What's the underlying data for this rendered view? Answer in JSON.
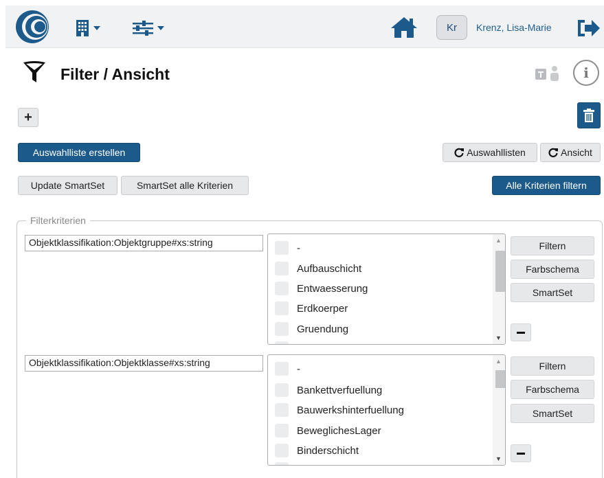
{
  "header": {
    "user_initials": "Kr",
    "user_name": "Krenz, Lisa-Marie",
    "icons": [
      "logo-icon",
      "building-icon",
      "sliders-icon",
      "home-icon",
      "logout-icon"
    ]
  },
  "page": {
    "title": "Filter / Ansicht",
    "icons": [
      "funnel-icon",
      "teams-icon",
      "info-icon"
    ],
    "info_glyph": "i"
  },
  "toolbar": {
    "add_label": "+",
    "create_list_label": "Auswahlliste erstellen",
    "refresh_lists_label": "Auswahllisten",
    "refresh_view_label": "Ansicht",
    "update_smartset_label": "Update SmartSet",
    "smartset_all_label": "SmartSet alle Kriterien",
    "filter_all_label": "Alle Kriterien filtern"
  },
  "filter_section": {
    "legend": "Filterkriterien",
    "criteria": [
      {
        "field": "Objektklassifikation:Objektgruppe#xs:string",
        "options": [
          "-",
          "Aufbauschicht",
          "Entwaesserung",
          "Erdkoerper",
          "Gruendung"
        ],
        "buttons": {
          "filter": "Filtern",
          "color": "Farbschema",
          "smartset": "SmartSet"
        }
      },
      {
        "field": "Objektklassifikation:Objektklasse#xs:string",
        "options": [
          "-",
          "Bankettverfuellung",
          "Bauwerkshinterfuellung",
          "BeweglichesLager",
          "Binderschicht"
        ],
        "buttons": {
          "filter": "Filtern",
          "color": "Farbschema",
          "smartset": "SmartSet"
        }
      }
    ]
  },
  "colors": {
    "primary_blue": "#1b5a8a",
    "logo_blue": "#1b5a8a",
    "topbar_bg": "#f1f2f4",
    "button_grey": "#e7e8ea"
  }
}
